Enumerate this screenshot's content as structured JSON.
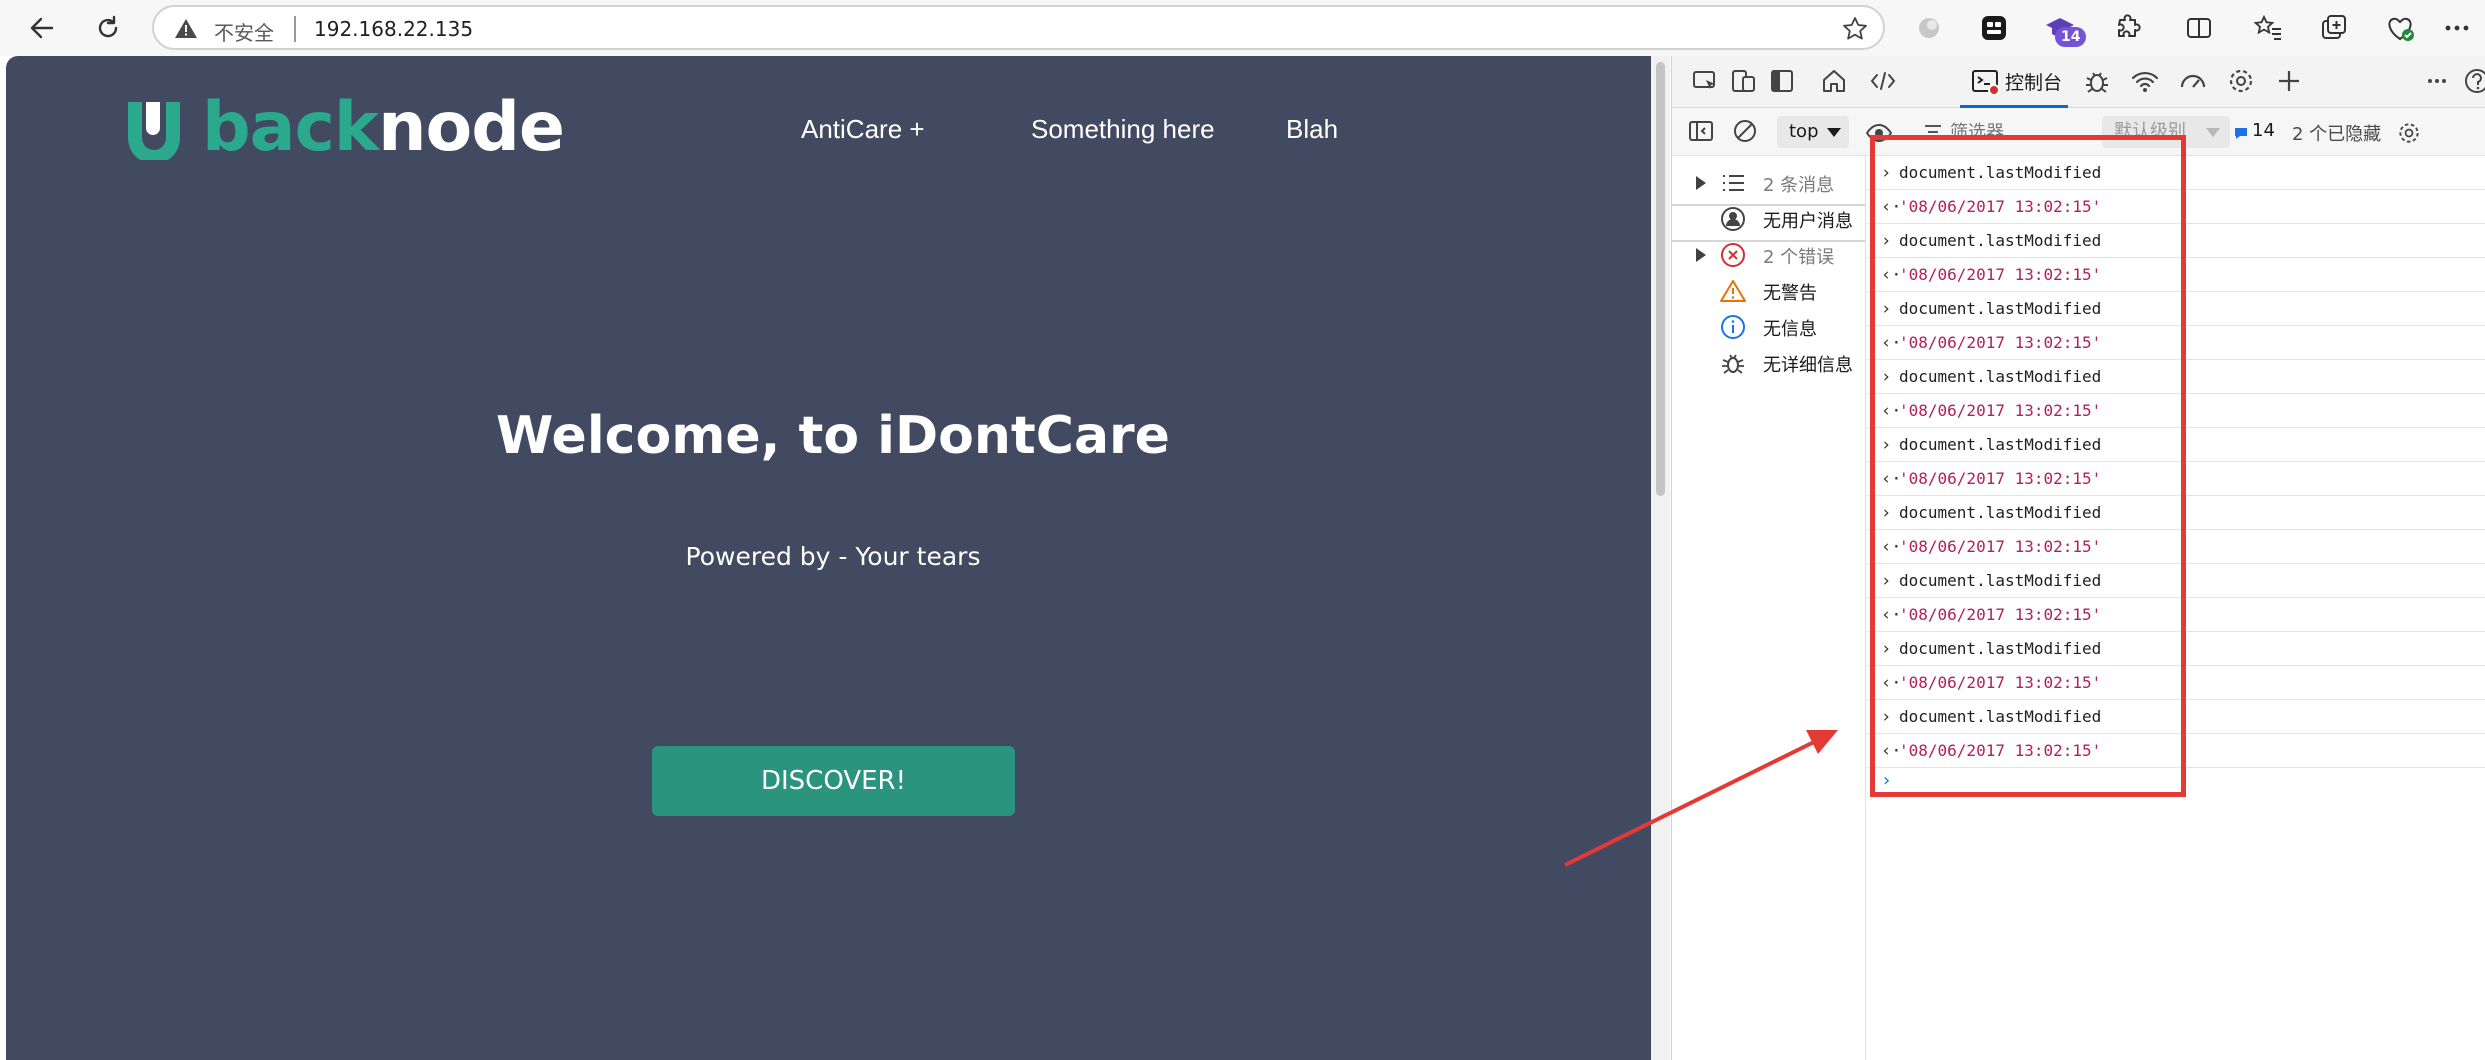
{
  "browser": {
    "security_label": "不安全",
    "url": "192.168.22.135",
    "extension_badge": "14"
  },
  "website": {
    "logo_part1": "back",
    "logo_part2": "node",
    "nav": [
      "AntiCare +",
      "Something here",
      "Blah"
    ],
    "hero_title": "Welcome, to iDontCare",
    "hero_subtitle": "Powered by - Your tears",
    "cta_label": "DISCOVER!",
    "colors": {
      "background": "#414a61",
      "accent": "#2a947e",
      "logo_accent": "#2ba98d"
    }
  },
  "devtools": {
    "console_tab_label": "控制台",
    "context": "top",
    "filter_placeholder": "筛选器",
    "level": "默认级别",
    "message_count": "14",
    "hidden_label": "2 个已隐藏",
    "sidebar": [
      {
        "label": "2 条消息",
        "icon": "list-icon",
        "expandable": true
      },
      {
        "label": "无用户消息",
        "icon": "user-icon",
        "expandable": false
      },
      {
        "label": "2 个错误",
        "icon": "error-icon",
        "expandable": true
      },
      {
        "label": "无警告",
        "icon": "warning-icon",
        "expandable": false
      },
      {
        "label": "无信息",
        "icon": "info-icon",
        "expandable": false
      },
      {
        "label": "无详细信息",
        "icon": "bug-icon",
        "expandable": false
      }
    ],
    "log": [
      {
        "kind": "input",
        "prefix": "›",
        "text": "document.lastModified"
      },
      {
        "kind": "output",
        "prefix": "‹·",
        "text": "'08/06/2017 13:02:15'"
      },
      {
        "kind": "input",
        "prefix": "›",
        "text": "document.lastModified"
      },
      {
        "kind": "output",
        "prefix": "‹·",
        "text": "'08/06/2017 13:02:15'"
      },
      {
        "kind": "input",
        "prefix": "›",
        "text": "document.lastModified"
      },
      {
        "kind": "output",
        "prefix": "‹·",
        "text": "'08/06/2017 13:02:15'"
      },
      {
        "kind": "input",
        "prefix": "›",
        "text": "document.lastModified"
      },
      {
        "kind": "output",
        "prefix": "‹·",
        "text": "'08/06/2017 13:02:15'"
      },
      {
        "kind": "input",
        "prefix": "›",
        "text": "document.lastModified"
      },
      {
        "kind": "output",
        "prefix": "‹·",
        "text": "'08/06/2017 13:02:15'"
      },
      {
        "kind": "input",
        "prefix": "›",
        "text": "document.lastModified"
      },
      {
        "kind": "output",
        "prefix": "‹·",
        "text": "'08/06/2017 13:02:15'"
      },
      {
        "kind": "input",
        "prefix": "›",
        "text": "document.lastModified"
      },
      {
        "kind": "output",
        "prefix": "‹·",
        "text": "'08/06/2017 13:02:15'"
      },
      {
        "kind": "input",
        "prefix": "›",
        "text": "document.lastModified"
      },
      {
        "kind": "output",
        "prefix": "‹·",
        "text": "'08/06/2017 13:02:15'"
      },
      {
        "kind": "input",
        "prefix": "›",
        "text": "document.lastModified"
      },
      {
        "kind": "output",
        "prefix": "‹·",
        "text": "'08/06/2017 13:02:15'"
      }
    ],
    "prompt": "›",
    "colors": {
      "output_string": "#b11f5a",
      "active_tab": "#0b69c7",
      "annotation": "#e53935"
    }
  }
}
